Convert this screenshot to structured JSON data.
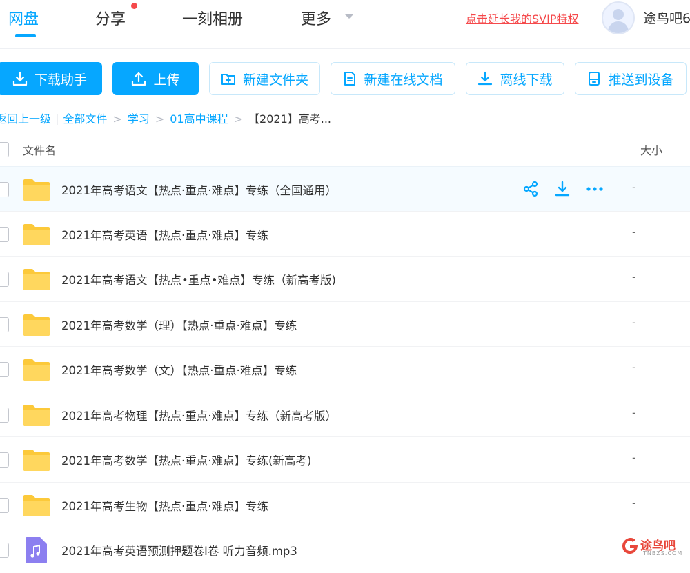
{
  "nav": {
    "tabs": [
      {
        "label": "网盘",
        "active": true
      },
      {
        "label": "分享",
        "has_dot": true
      },
      {
        "label": "一刻相册"
      },
      {
        "label": "更多",
        "has_dropdown": true
      }
    ],
    "svip_link": "点击延长我的SVIP特权",
    "username": "途鸟吧6",
    "accent_color": "#06a7ff",
    "alert_color": "#f5494b"
  },
  "toolbar": {
    "download_helper": "下载助手",
    "upload": "上传",
    "new_folder": "新建文件夹",
    "new_online_doc": "新建在线文档",
    "offline_download": "离线下载",
    "push_to_device": "推送到设备"
  },
  "breadcrumb": {
    "back": "返回上一级",
    "items": [
      "全部文件",
      "学习",
      "01高中课程"
    ],
    "current": "【2021】高考..."
  },
  "table": {
    "headers": {
      "name": "文件名",
      "size": "大小"
    },
    "rows": [
      {
        "name": "2021年高考语文【热点·重点·难点】专练（全国通用）",
        "size": "-",
        "type": "folder",
        "hovered": true
      },
      {
        "name": "2021年高考英语【热点·重点·难点】专练",
        "size": "-",
        "type": "folder"
      },
      {
        "name": "2021年高考语文【热点•重点•难点】专练（新高考版)",
        "size": "-",
        "type": "folder"
      },
      {
        "name": "2021年高考数学（理）【热点·重点·难点】专练",
        "size": "-",
        "type": "folder"
      },
      {
        "name": "2021年高考数学（文）【热点·重点·难点】专练",
        "size": "-",
        "type": "folder"
      },
      {
        "name": "2021年高考物理【热点·重点·难点】专练（新高考版）",
        "size": "-",
        "type": "folder"
      },
      {
        "name": "2021年高考数学【热点·重点·难点】专练(新高考)",
        "size": "-",
        "type": "folder"
      },
      {
        "name": "2021年高考生物【热点·重点·难点】专练",
        "size": "-",
        "type": "folder"
      },
      {
        "name": "2021年高考英语预测押题卷I卷 听力音频.mp3",
        "size": "",
        "type": "audio"
      }
    ],
    "row_actions": [
      "share-icon",
      "download-icon",
      "more-icon"
    ]
  },
  "watermark": {
    "text": "途鸟吧",
    "sub": "TNBZS.COM"
  }
}
